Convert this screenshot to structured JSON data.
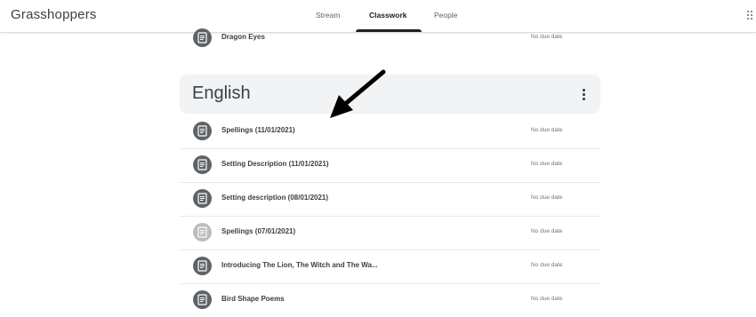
{
  "header": {
    "class_name": "Grasshoppers",
    "tabs": [
      {
        "label": "Stream",
        "active": false
      },
      {
        "label": "Classwork",
        "active": true
      },
      {
        "label": "People",
        "active": false
      }
    ],
    "apps_icon": "apps-grid-icon"
  },
  "previous_item": {
    "title": "Dragon Eyes",
    "due": "No due date",
    "icon": "assignment-icon"
  },
  "topic": {
    "title": "English",
    "more_icon": "more-vert-icon",
    "items": [
      {
        "title": "Spellings (11/01/2021)",
        "due": "No due date",
        "icon": "assignment-icon",
        "faded": false
      },
      {
        "title": "Setting Description (11/01/2021)",
        "due": "No due date",
        "icon": "assignment-icon",
        "faded": false
      },
      {
        "title": "Setting description (08/01/2021)",
        "due": "No due date",
        "icon": "assignment-icon",
        "faded": false
      },
      {
        "title": "Spellings (07/01/2021)",
        "due": "No due date",
        "icon": "assignment-icon",
        "faded": true
      },
      {
        "title": "Introducing The Lion, The Witch and The Wa...",
        "due": "No due date",
        "icon": "assignment-icon",
        "faded": false
      },
      {
        "title": "Bird Shape Poems",
        "due": "No due date",
        "icon": "assignment-icon",
        "faded": false
      }
    ]
  },
  "colors": {
    "icon_bg": "#5f6368",
    "icon_bg_faded": "#bdbdbd",
    "topic_bg": "#f1f3f4",
    "divider": "#e8eaed",
    "annotation_arrow": "#000000"
  }
}
